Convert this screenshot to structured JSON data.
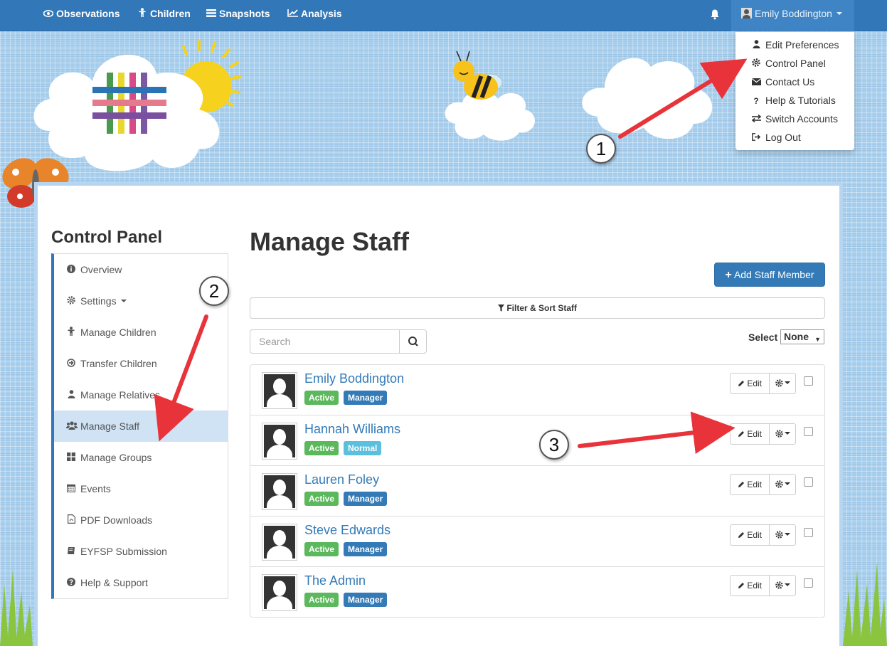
{
  "topnav": {
    "items": [
      {
        "label": "Observations",
        "icon": "eye-icon"
      },
      {
        "label": "Children",
        "icon": "child-icon"
      },
      {
        "label": "Snapshots",
        "icon": "list-icon"
      },
      {
        "label": "Analysis",
        "icon": "line-chart-icon"
      }
    ],
    "user_name": "Emily Boddington"
  },
  "user_menu": [
    {
      "label": "Edit Preferences",
      "icon": "user-icon"
    },
    {
      "label": "Control Panel",
      "icon": "cog-icon"
    },
    {
      "label": "Contact Us",
      "icon": "envelope-icon"
    },
    {
      "label": "Help & Tutorials",
      "icon": "question-icon"
    },
    {
      "label": "Switch Accounts",
      "icon": "exchange-icon"
    },
    {
      "label": "Log Out",
      "icon": "sign-out-icon"
    }
  ],
  "sidebar": {
    "title": "Control Panel",
    "items": [
      {
        "label": "Overview",
        "icon": "info-circle-icon"
      },
      {
        "label": "Settings",
        "icon": "cog-icon"
      },
      {
        "label": "Manage Children",
        "icon": "child-icon"
      },
      {
        "label": "Transfer Children",
        "icon": "arrow-circle-icon"
      },
      {
        "label": "Manage Relatives",
        "icon": "user-icon"
      },
      {
        "label": "Manage Staff",
        "icon": "users-icon",
        "active": true
      },
      {
        "label": "Manage Groups",
        "icon": "th-large-icon"
      },
      {
        "label": "Events",
        "icon": "calendar-icon"
      },
      {
        "label": "PDF Downloads",
        "icon": "pdf-file-icon"
      },
      {
        "label": "EYFSP Submission",
        "icon": "book-icon"
      },
      {
        "label": "Help & Support",
        "icon": "question-circle-icon"
      }
    ]
  },
  "main": {
    "title": "Manage Staff",
    "add_button": "Add Staff Member",
    "filter_label": "Filter & Sort Staff",
    "search_placeholder": "Search",
    "select_label": "Select",
    "select_value": "None",
    "edit_label": "Edit",
    "staff": [
      {
        "name": "Emily Boddington",
        "status": "Active",
        "role": "Manager"
      },
      {
        "name": "Hannah Williams",
        "status": "Active",
        "role": "Normal"
      },
      {
        "name": "Lauren Foley",
        "status": "Active",
        "role": "Manager"
      },
      {
        "name": "Steve Edwards",
        "status": "Active",
        "role": "Manager"
      },
      {
        "name": "The Admin",
        "status": "Active",
        "role": "Manager"
      }
    ]
  },
  "annotations": {
    "step1": "1",
    "step2": "2",
    "step3": "3"
  },
  "colors": {
    "nav_blue": "#3278b9",
    "primary": "#337ab7",
    "active_green": "#5cb85c",
    "normal_cyan": "#5bc0de",
    "manager_blue": "#337ab7",
    "arrow_red": "#e8333a"
  }
}
